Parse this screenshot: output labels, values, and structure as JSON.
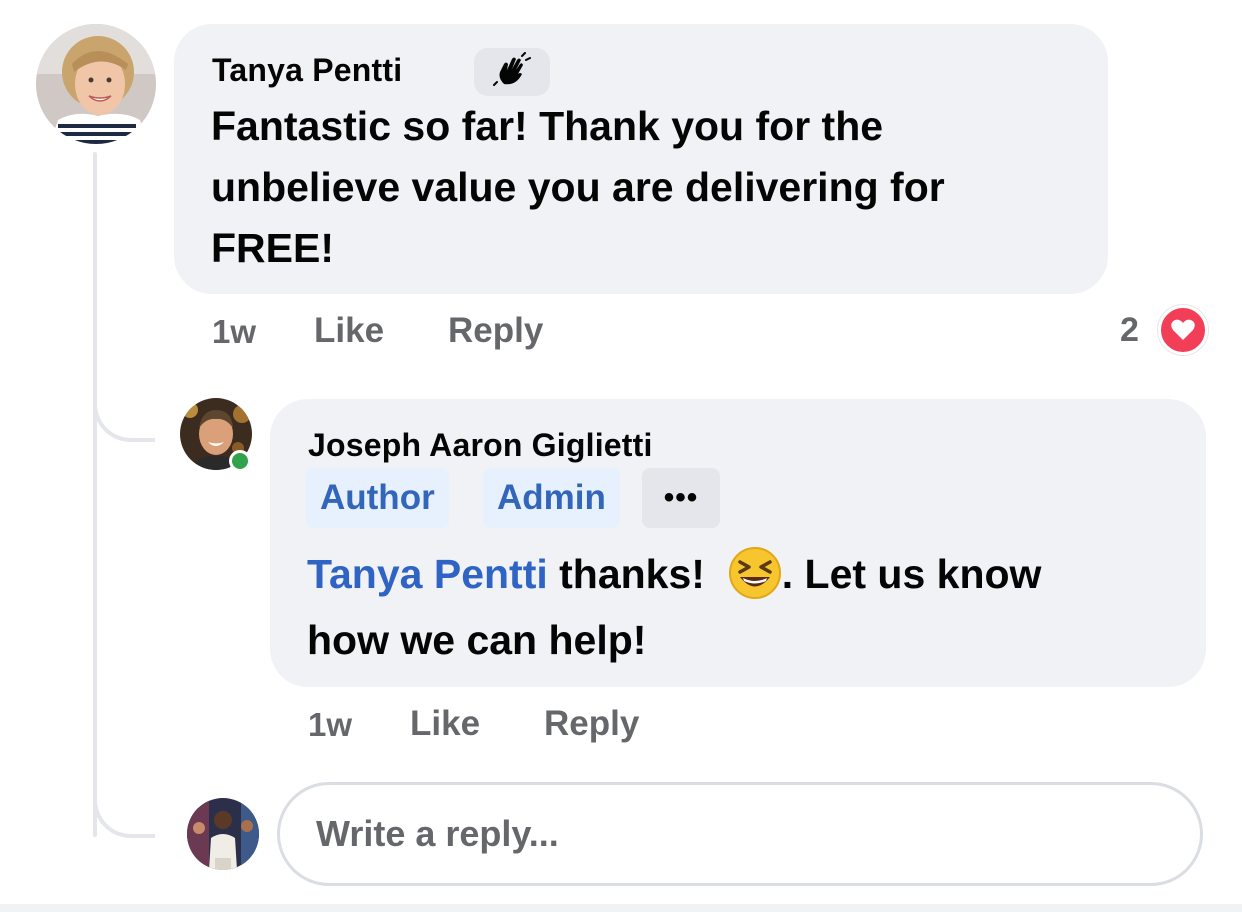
{
  "comment": {
    "author": "Tanya Pentti",
    "badge_icon": "waving-hand-icon",
    "text_line1": "Fantastic so far! Thank you for the",
    "text_line2": "unbelieve value you are delivering for",
    "text_line3": "FREE!",
    "time": "1w",
    "like_label": "Like",
    "reply_label": "Reply",
    "reaction_count": "2",
    "reaction_icon": "love-reaction-icon",
    "reaction_color": "#f33e58"
  },
  "reply": {
    "author": "Joseph Aaron Giglietti",
    "online": true,
    "badges": [
      "Author",
      "Admin"
    ],
    "more_label": "•••",
    "mention": "Tanya Pentti",
    "text_part1": " thanks! ",
    "emoji_icon": "grinning-squinting-face-icon",
    "text_part2": ". Let us know",
    "text_line2": "how we can help!",
    "time": "1w",
    "like_label": "Like",
    "reply_label": "Reply"
  },
  "composer": {
    "placeholder": "Write a reply..."
  },
  "colors": {
    "bubble": "#f0f2f5",
    "mention": "#2f64c4",
    "badge_bg": "#e7f0fd",
    "badge_text": "#3366bb",
    "online": "#31a24c",
    "secondary_text": "#65676b"
  }
}
